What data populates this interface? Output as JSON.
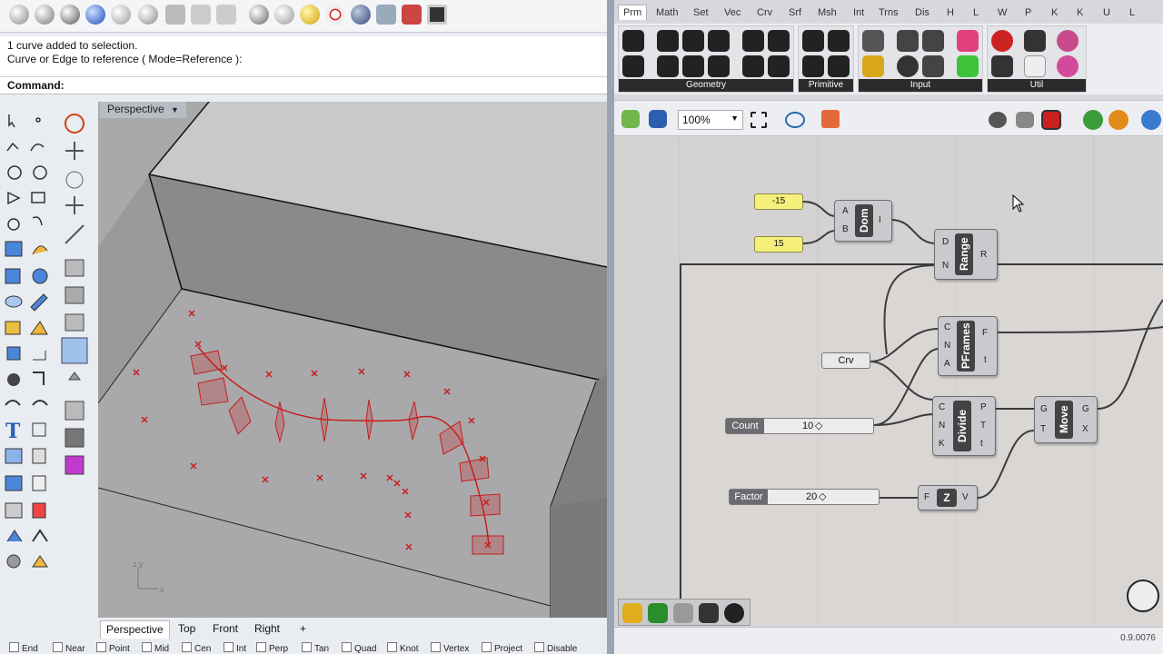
{
  "rhino": {
    "history": [
      "1 curve added to selection.",
      "Curve or Edge to reference ( Mode=Reference ):"
    ],
    "command_label": "Command:",
    "viewport_label": "Perspective",
    "axis_z": "z",
    "axis_y": "y",
    "axis_x": "x",
    "viewport_tabs": [
      "Perspective",
      "Top",
      "Front",
      "Right",
      "+"
    ],
    "osnaps": [
      "End",
      "Near",
      "Point",
      "Mid",
      "Cen",
      "Int",
      "Perp",
      "Tan",
      "Quad",
      "Knot",
      "Vertex",
      "Project",
      "Disable"
    ]
  },
  "grasshopper": {
    "tabs": [
      "Prm",
      "Math",
      "Set",
      "Vec",
      "Crv",
      "Srf",
      "Msh",
      "Int",
      "Trns",
      "Dis",
      "H",
      "L",
      "W",
      "P",
      "K",
      "K",
      "U",
      "L"
    ],
    "ribbon_groups": [
      "Geometry",
      "Primitive",
      "Input",
      "Util"
    ],
    "zoom": "100%",
    "version": "0.9.0076",
    "components": {
      "panel_a": "-15",
      "panel_b": "15",
      "dom": {
        "name": "Dom",
        "in": [
          "A",
          "B"
        ],
        "out": [
          "I"
        ]
      },
      "range": {
        "name": "Range",
        "in": [
          "D",
          "N"
        ],
        "out": [
          "R"
        ]
      },
      "pframes": {
        "name": "PFrames",
        "in": [
          "C",
          "N",
          "A"
        ],
        "out": [
          "F",
          "t"
        ]
      },
      "crv": "Crv",
      "divide": {
        "name": "Divide",
        "in": [
          "C",
          "N",
          "K"
        ],
        "out": [
          "P",
          "T",
          "t"
        ]
      },
      "move": {
        "name": "Move",
        "in": [
          "G",
          "T"
        ],
        "out": [
          "G",
          "X"
        ]
      },
      "unit_z": {
        "name": "Z",
        "in": [
          "F"
        ],
        "out": [
          "V"
        ]
      },
      "count": {
        "label": "Count",
        "value": "10"
      },
      "factor": {
        "label": "Factor",
        "value": "20"
      }
    }
  },
  "colors": {
    "curve_red": "#c81e1e",
    "panel_yellow": "#f4f07a",
    "gh_dark": "#434346"
  }
}
